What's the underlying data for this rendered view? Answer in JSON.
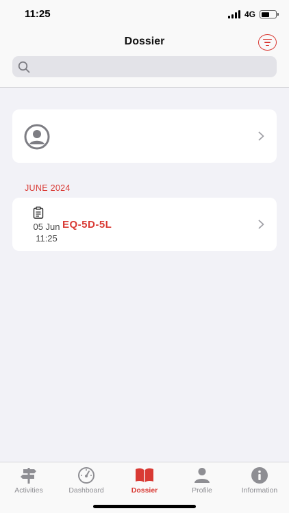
{
  "status_bar": {
    "time": "11:25",
    "network": "4G",
    "battery_level": 0.55
  },
  "header": {
    "title": "Dossier"
  },
  "search": {
    "placeholder": "",
    "value": ""
  },
  "section": {
    "header": "JUNE 2024"
  },
  "entries": [
    {
      "date": "05 Jun",
      "time": "11:25",
      "title": "EQ-5D-5L"
    }
  ],
  "tabs": [
    {
      "label": "Activities",
      "icon": "signpost-icon",
      "active": false
    },
    {
      "label": "Dashboard",
      "icon": "gauge-icon",
      "active": false
    },
    {
      "label": "Dossier",
      "icon": "book-icon",
      "active": true
    },
    {
      "label": "Profile",
      "icon": "person-icon",
      "active": false
    },
    {
      "label": "Information",
      "icon": "info-icon",
      "active": false
    }
  ],
  "colors": {
    "accent": "#d93a34",
    "inactive": "#8e8e93",
    "background": "#f2f2f7"
  }
}
